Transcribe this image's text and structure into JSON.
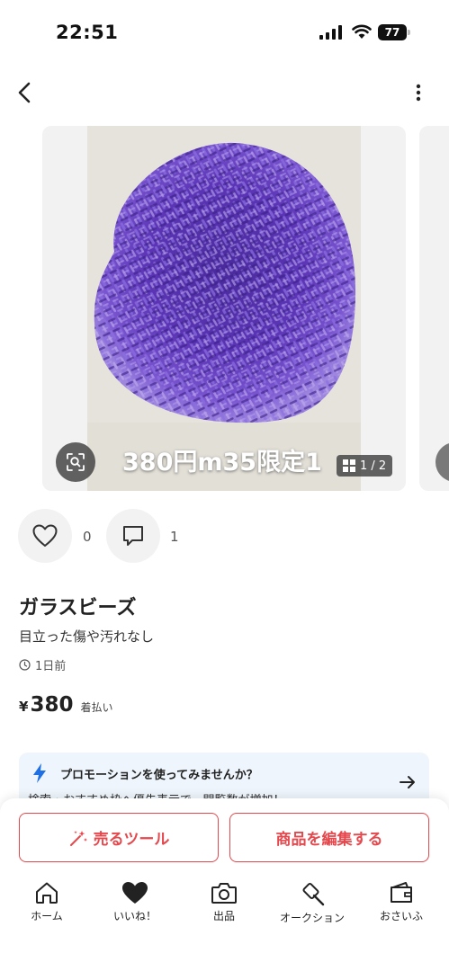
{
  "status": {
    "time": "22:51",
    "battery": "77"
  },
  "product": {
    "overlay_text": "380円m35限定1",
    "image_counter": "1 / 2",
    "like_count": "0",
    "comment_count": "1",
    "title": "ガラスビーズ",
    "condition": "目立った傷や汚れなし",
    "posted": "1日前",
    "price_symbol": "¥",
    "price": "380",
    "shipping": "着払い"
  },
  "promo": {
    "title": "プロモーションを使ってみませんか？",
    "subtitle": "検索・おすすめ枠へ優先表示で、閲覧数が増加！"
  },
  "buttons": {
    "sell_tool": "売るツール",
    "edit_item": "商品を編集する"
  },
  "tabs": [
    {
      "label": "ホーム",
      "icon": "home-icon"
    },
    {
      "label": "いいね！",
      "icon": "heart-icon"
    },
    {
      "label": "出品",
      "icon": "camera-icon"
    },
    {
      "label": "オークション",
      "icon": "gavel-icon"
    },
    {
      "label": "おさいふ",
      "icon": "wallet-icon"
    }
  ],
  "colors": {
    "accent": "#e5484d",
    "promo_bg": "#eef5fc",
    "promo_icon": "#1f6fe5",
    "bead": "#6a3fc1"
  }
}
